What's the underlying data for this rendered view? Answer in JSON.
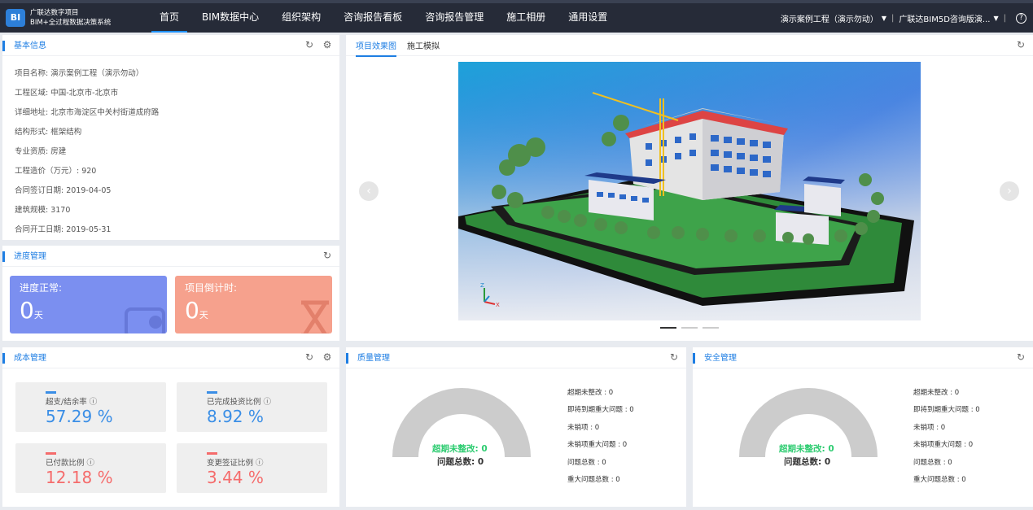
{
  "header": {
    "logo_text": "BI",
    "brand_line1": "广联达数字项目",
    "brand_line2": "BIM+全过程数据决策系统",
    "nav": [
      "首页",
      "BIM数据中心",
      "组织架构",
      "咨询报告看板",
      "咨询报告管理",
      "施工相册",
      "通用设置"
    ],
    "project_select": "演示案例工程（演示勿动）",
    "org_select": "广联达BIM5D咨询版演...",
    "help": "?"
  },
  "basic_info": {
    "title": "基本信息",
    "rows": [
      "项目名称:   演示案例工程（演示勿动）",
      "工程区域:   中国-北京市-北京市",
      "详细地址:   北京市海淀区中关村街道成府路",
      "结构形式:   框架结构",
      "专业资质:   房建",
      "工程造价（万元）:   920",
      "合同签订日期:   2019-04-05",
      "建筑规模:   3170",
      "合同开工日期:   2019-05-31"
    ]
  },
  "progress": {
    "title": "进度管理",
    "card1_label": "进度正常:",
    "card1_value": "0",
    "card1_unit": "天",
    "card2_label": "项目倒计时:",
    "card2_value": "0",
    "card2_unit": "天",
    "card1_color": "#7b8ff0",
    "card2_color": "#f6a18d"
  },
  "cost": {
    "title": "成本管理",
    "items": [
      {
        "label": "超支/结余率 ⓘ",
        "value": "57.29 %"
      },
      {
        "label": "已完成投资比例 ⓘ",
        "value": "8.92 %"
      },
      {
        "label": "已付款比例 ⓘ",
        "value": "12.18 %"
      },
      {
        "label": "变更签证比例 ⓘ",
        "value": "3.44 %"
      }
    ],
    "blue": "#3a8ee6",
    "red": "#f56c6c"
  },
  "render": {
    "tab1": "项目效果图",
    "tab2": "施工模拟",
    "prev": "‹",
    "next": "›",
    "axis_z": "Z",
    "axis_x": "X"
  },
  "quality": {
    "title": "质量管理",
    "gauge_overdue": "超期未整改: 0",
    "gauge_total": "问题总数:  0",
    "stats": [
      "超期未整改 : 0",
      "即将到期重大问题 : 0",
      "未销项 : 0",
      "未销项重大问题 : 0",
      "问题总数 : 0",
      "重大问题总数 : 0"
    ]
  },
  "safety": {
    "title": "安全管理",
    "gauge_overdue": "超期未整改: 0",
    "gauge_total": "问题总数:  0",
    "stats": [
      "超期未整改 : 0",
      "即将到期重大问题 : 0",
      "未销项 : 0",
      "未销项重大问题 : 0",
      "问题总数 : 0",
      "重大问题总数 : 0"
    ]
  },
  "icons": {
    "refresh": "refresh-icon",
    "settings": "gear-icon"
  }
}
